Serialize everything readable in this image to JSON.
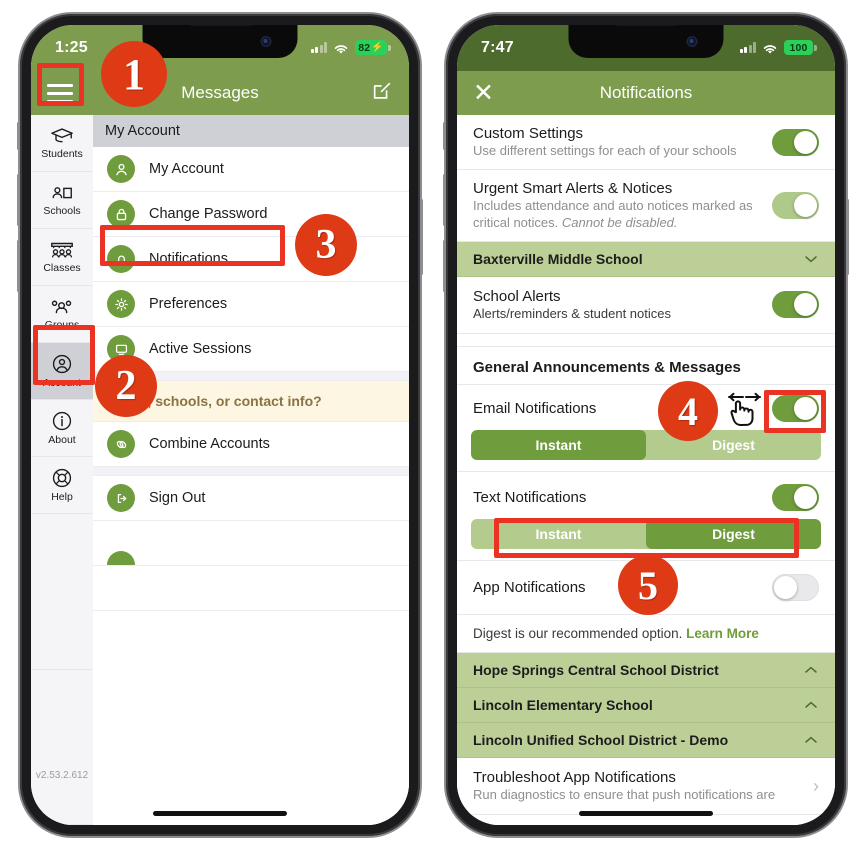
{
  "annotations": {
    "steps": [
      {
        "id": "1",
        "label": "1",
        "target": "hamburger-menu"
      },
      {
        "id": "2",
        "label": "2",
        "target": "sidebar-item-account"
      },
      {
        "id": "3",
        "label": "3",
        "target": "menu-item-notifications"
      },
      {
        "id": "4",
        "label": "4",
        "target": "email-notifications-toggle"
      },
      {
        "id": "5",
        "label": "5",
        "target": "text-notifications-segmented"
      }
    ],
    "accent_color": "#de3a16",
    "highlight_color": "#ea3323",
    "gesture_icon": "swipe-hand-icon"
  },
  "left_phone": {
    "status_bar": {
      "time": "1:25",
      "battery_level": "82",
      "charging": true,
      "wifi_icon": "wifi-icon",
      "signal_icon": "cellular-signal-icon"
    },
    "app_bar": {
      "menu_icon": "hamburger-menu-icon",
      "title": "Messages",
      "compose_icon": "compose-icon"
    },
    "rail": {
      "items": [
        {
          "label": "Students",
          "icon": "graduation-cap-icon",
          "active": false
        },
        {
          "label": "Schools",
          "icon": "school-building-icon",
          "active": false
        },
        {
          "label": "Classes",
          "icon": "classroom-icon",
          "active": false
        },
        {
          "label": "Groups",
          "icon": "groups-icon",
          "active": false
        },
        {
          "label": "Account",
          "icon": "account-circle-icon",
          "active": true
        },
        {
          "label": "About",
          "icon": "info-circle-icon",
          "active": false
        },
        {
          "label": "Help",
          "icon": "life-ring-icon",
          "active": false
        }
      ],
      "version": "v2.53.2.612"
    },
    "menu": {
      "section_title": "My Account",
      "items": [
        {
          "label": "My Account",
          "icon": "person-icon"
        },
        {
          "label": "Change Password",
          "icon": "lock-icon"
        },
        {
          "label": "Notifications",
          "icon": "bell-icon"
        },
        {
          "label": "Preferences",
          "icon": "gear-icon"
        },
        {
          "label": "Active Sessions",
          "icon": "monitor-icon"
        }
      ],
      "banner": "g kids, schools, or contact info?",
      "items_after": [
        {
          "label": "Combine Accounts",
          "icon": "link-icon"
        },
        {
          "label": "Sign Out",
          "icon": "sign-out-icon"
        }
      ]
    }
  },
  "right_phone": {
    "status_bar": {
      "time": "7:47",
      "battery_level": "100",
      "charging": false,
      "wifi_icon": "wifi-icon",
      "signal_icon": "cellular-signal-icon"
    },
    "app_bar": {
      "close_icon": "close-icon",
      "title": "Notifications"
    },
    "settings": {
      "custom_settings": {
        "title": "Custom Settings",
        "subtitle": "Use different settings for each of your schools",
        "toggle": "on"
      },
      "urgent_alerts": {
        "title": "Urgent Smart Alerts & Notices",
        "subtitle_part1": "Includes attendance and auto notices marked as critical notices. ",
        "subtitle_italic": "Cannot be disabled.",
        "toggle": "on-disabled"
      },
      "school_header": {
        "name": "Baxterville Middle School",
        "chevron": "chevron-down-icon"
      },
      "school_alerts": {
        "title": "School Alerts",
        "subtitle": "Alerts/reminders & student notices",
        "toggle": "on"
      },
      "group_header": "General Announcements & Messages",
      "email_notifications": {
        "title": "Email Notifications",
        "toggle": "on",
        "segment_options": [
          "Instant",
          "Digest"
        ],
        "selected": "Instant"
      },
      "text_notifications": {
        "title": "Text Notifications",
        "toggle": "on",
        "segment_options": [
          "Instant",
          "Digest"
        ],
        "selected": "Digest"
      },
      "app_notifications": {
        "title": "App Notifications",
        "toggle": "off"
      },
      "recommendation": {
        "text": "Digest is our recommended option. ",
        "link": "Learn More"
      },
      "collapsed_schools": [
        {
          "name": "Hope Springs Central School District",
          "chevron": "chevron-up-icon"
        },
        {
          "name": "Lincoln Elementary School",
          "chevron": "chevron-up-icon"
        },
        {
          "name": "Lincoln Unified School District - Demo",
          "chevron": "chevron-up-icon"
        }
      ],
      "troubleshoot": {
        "title": "Troubleshoot App Notifications",
        "subtitle": "Run diagnostics to ensure that push notifications are",
        "arrow": "chevron-right-icon"
      }
    }
  }
}
